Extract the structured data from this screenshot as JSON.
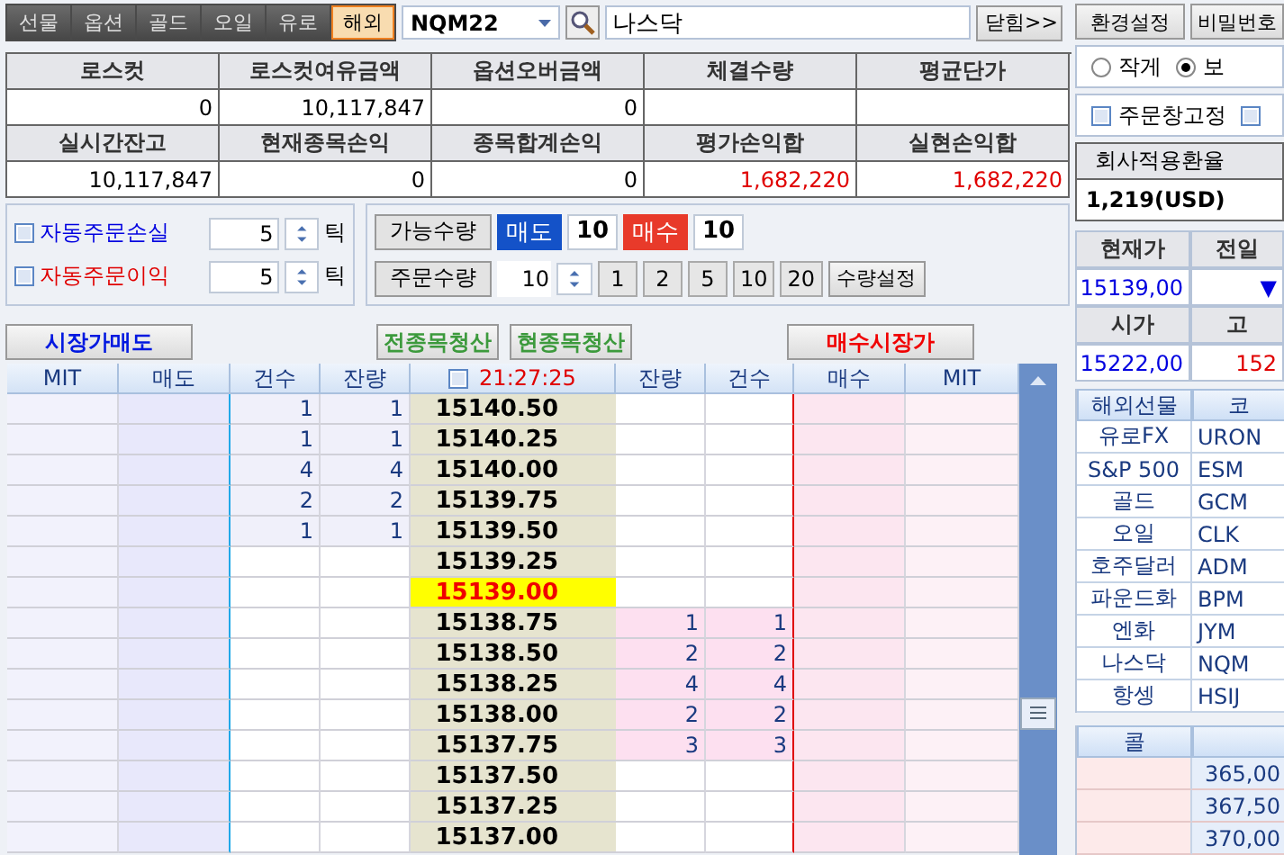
{
  "market_tabs": [
    {
      "label": "선물",
      "selected": false
    },
    {
      "label": "옵션",
      "selected": false
    },
    {
      "label": "골드",
      "selected": false
    },
    {
      "label": "오일",
      "selected": false
    },
    {
      "label": "유로",
      "selected": false
    },
    {
      "label": "해외",
      "selected": true
    }
  ],
  "symbol_combo": {
    "value": "NQM22"
  },
  "symbol_name": {
    "value": "나스닥"
  },
  "collapse_button": "닫힘>>",
  "settings_buttons": [
    "환경설정",
    "비밀번호"
  ],
  "summary": [
    [
      {
        "label": "로스컷",
        "value": "0",
        "positive": false
      },
      {
        "label": "로스컷여유금액",
        "value": "10,117,847",
        "positive": false
      },
      {
        "label": "옵션오버금액",
        "value": "0",
        "positive": false
      },
      {
        "label": "체결수량"
      },
      {
        "label": "평균단가"
      }
    ],
    [
      {
        "label": "실시간잔고",
        "value": "10,117,847",
        "positive": false
      },
      {
        "label": "현재종목손익",
        "value": "0",
        "positive": false
      },
      {
        "label": "종목합계손익",
        "value": "0",
        "positive": false
      },
      {
        "label": "평가손익합",
        "value": "1,682,220",
        "positive": true
      },
      {
        "label": "실현손익합",
        "value": "1,682,220",
        "positive": true
      }
    ]
  ],
  "auto_orders": [
    {
      "label": "자동주문손실",
      "checked": false,
      "value": "5",
      "unit": "틱",
      "kind": "loss"
    },
    {
      "label": "자동주문이익",
      "checked": false,
      "value": "5",
      "unit": "틱",
      "kind": "profit"
    }
  ],
  "available": {
    "label": "가능수량",
    "sell_label": "매도",
    "sell_qty": "10",
    "buy_label": "매수",
    "buy_qty": "10"
  },
  "order_qty": {
    "label": "주문수량",
    "value": "10",
    "presets": [
      "1",
      "2",
      "5",
      "10",
      "20"
    ],
    "set_button": "수량설정"
  },
  "action_buttons": [
    {
      "label": "시장가매도",
      "kind": "sell"
    },
    {
      "label": "전종목청산",
      "kind": "clear"
    },
    {
      "label": "현종목청산",
      "kind": "clear"
    },
    {
      "label": "매수시장가",
      "kind": "buy"
    }
  ],
  "book": {
    "columns_left": [
      "MIT",
      "매도",
      "건수",
      "잔량"
    ],
    "lock_checked": false,
    "time": "21:27:25",
    "columns_right": [
      "잔량",
      "건수",
      "매수",
      "MIT"
    ],
    "rows": [
      {
        "price": "15140.50",
        "sell_count": "1",
        "sell_qty": "1",
        "current": false
      },
      {
        "price": "15140.25",
        "sell_count": "1",
        "sell_qty": "1",
        "current": false
      },
      {
        "price": "15140.00",
        "sell_count": "4",
        "sell_qty": "4",
        "current": false
      },
      {
        "price": "15139.75",
        "sell_count": "2",
        "sell_qty": "2",
        "current": false
      },
      {
        "price": "15139.50",
        "sell_count": "1",
        "sell_qty": "1",
        "current": false
      },
      {
        "price": "15139.25",
        "current": false
      },
      {
        "price": "15139.00",
        "current": true
      },
      {
        "price": "15138.75",
        "buy_qty": "1",
        "buy_count": "1",
        "current": false
      },
      {
        "price": "15138.50",
        "buy_qty": "2",
        "buy_count": "2",
        "current": false
      },
      {
        "price": "15138.25",
        "buy_qty": "4",
        "buy_count": "4",
        "current": false
      },
      {
        "price": "15138.00",
        "buy_qty": "2",
        "buy_count": "2",
        "current": false
      },
      {
        "price": "15137.75",
        "buy_qty": "3",
        "buy_count": "3",
        "current": false
      },
      {
        "price": "15137.50",
        "current": false
      },
      {
        "price": "15137.25",
        "current": false
      },
      {
        "price": "15137.00",
        "current": false
      }
    ]
  },
  "size_options": [
    {
      "label": "작게",
      "selected": false
    },
    {
      "label": "보",
      "selected": true
    }
  ],
  "pin_options": [
    {
      "label": "주문창고정",
      "checked": false
    },
    {
      "checked": false
    }
  ],
  "exchange_rate": {
    "label": "회사적용환율",
    "value": "1,219(USD)"
  },
  "quote": [
    [
      {
        "label": "현재가",
        "value": "15139,00",
        "kind": "down"
      },
      {
        "label": "전일",
        "value": "▼",
        "kind": "down"
      }
    ],
    [
      {
        "label": "시가",
        "value": "15222,00",
        "kind": "down"
      },
      {
        "label": "고",
        "value": "152",
        "kind": "up"
      }
    ]
  ],
  "futures_list": {
    "columns": [
      "해외선물",
      "코"
    ],
    "rows": [
      {
        "name": "유로FX",
        "code": "URON"
      },
      {
        "name": "S&P 500",
        "code": "ESM"
      },
      {
        "name": "골드",
        "code": "GCM"
      },
      {
        "name": "오일",
        "code": "CLK"
      },
      {
        "name": "호주달러",
        "code": "ADM"
      },
      {
        "name": "파운드화",
        "code": "BPM"
      },
      {
        "name": "엔화",
        "code": "JYM"
      },
      {
        "name": "나스닥",
        "code": "NQM"
      },
      {
        "name": "항셍",
        "code": "HSIJ"
      }
    ]
  },
  "options_table": {
    "columns": [
      "콜"
    ],
    "rows": [
      "365,00",
      "367,50",
      "370,00"
    ]
  }
}
